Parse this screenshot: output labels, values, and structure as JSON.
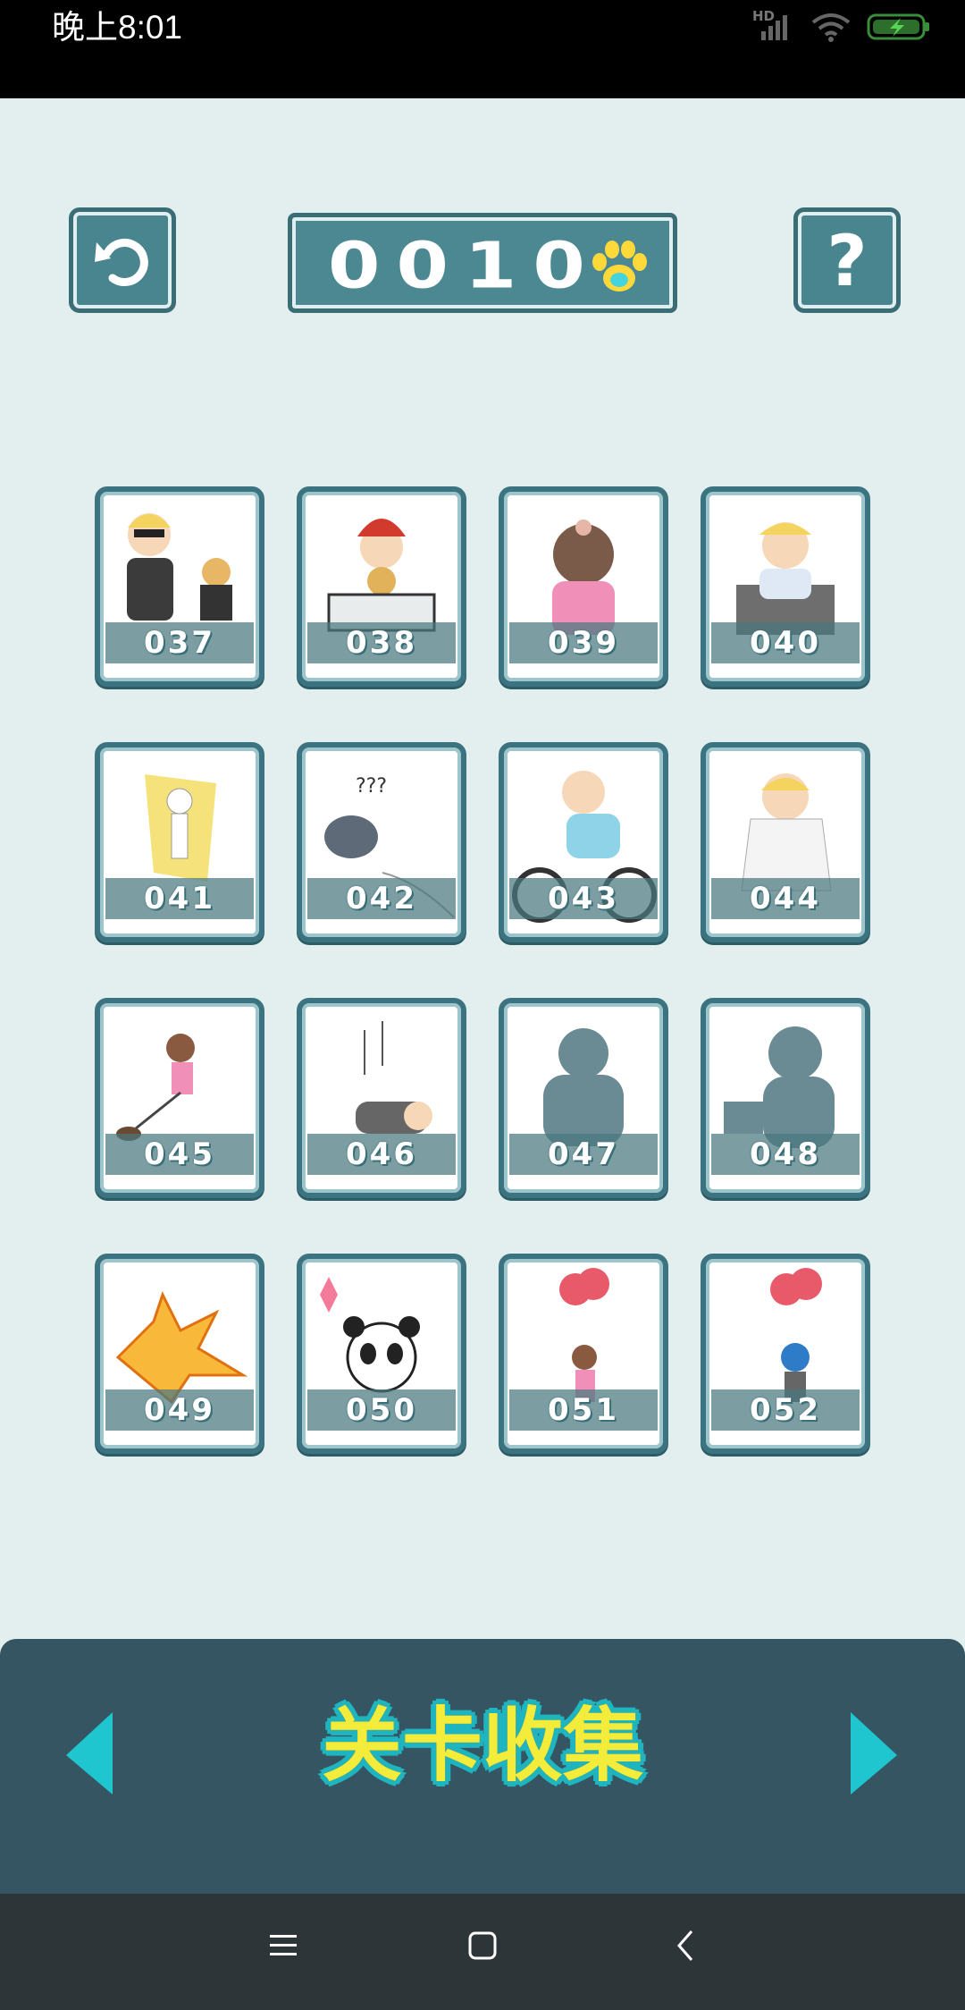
{
  "status_bar": {
    "time": "晚上8:01",
    "network_label": "HD"
  },
  "header": {
    "score": "0010",
    "score_icon": "paw-icon",
    "back_icon": "undo-icon",
    "help_icon": "help-icon"
  },
  "levels": [
    {
      "num": "037",
      "art": "magician"
    },
    {
      "num": "038",
      "art": "santa-table"
    },
    {
      "num": "039",
      "art": "girl-back"
    },
    {
      "num": "040",
      "art": "baby-box"
    },
    {
      "num": "041",
      "art": "electric-skeleton"
    },
    {
      "num": "042",
      "art": "flying-cat"
    },
    {
      "num": "043",
      "art": "bike-rider"
    },
    {
      "num": "044",
      "art": "ghost-cap"
    },
    {
      "num": "045",
      "art": "shovel-girl"
    },
    {
      "num": "046",
      "art": "fallen-boy"
    },
    {
      "num": "047",
      "art": "silhouette-cat"
    },
    {
      "num": "048",
      "art": "silhouette-girl"
    },
    {
      "num": "049",
      "art": "explosion"
    },
    {
      "num": "050",
      "art": "panda"
    },
    {
      "num": "051",
      "art": "balloon-girl"
    },
    {
      "num": "052",
      "art": "balloon-boy"
    }
  ],
  "footer": {
    "title": "关卡收集",
    "prev_icon": "arrow-left-icon",
    "next_icon": "arrow-right-icon"
  },
  "colors": {
    "panel": "#355562",
    "accent": "#1fc6cf",
    "title": "#f4ec3a",
    "card_border": "#3b7480"
  }
}
